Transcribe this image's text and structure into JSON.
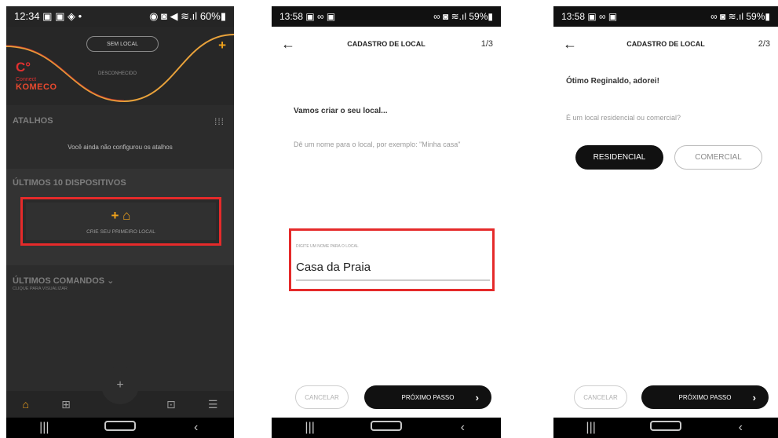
{
  "phone1": {
    "status": {
      "time": "12:34",
      "icons": "▣ ▣ ◈ •",
      "right_icons": "◉ ◙ ◀ ≋.ıl",
      "battery": "60%"
    },
    "location_pill": "SEM LOCAL",
    "add_symbol": "+",
    "logo": {
      "mark": "C°",
      "word": "Connect",
      "brand": "KOMECO"
    },
    "disconnected": "DESCONHECIDO",
    "shortcuts_title": "ATALHOS",
    "shortcuts_empty": "Você ainda não configurou os atalhos",
    "devices_title": "ÚLTIMOS 10 DISPOSITIVOS",
    "create_card": {
      "icons": "+ ⌂",
      "label": "CRIE SEU PRIMEIRO LOCAL"
    },
    "commands_title": "ÚLTIMOS COMANDOS ⌄",
    "commands_sub": "CLIQUE PARA VISUALIZAR",
    "bottom_nav": [
      "⌂",
      "⊞",
      "⊡",
      "☰"
    ],
    "fab": "+",
    "nav": [
      "|||",
      "○",
      "‹"
    ]
  },
  "phone2": {
    "status": {
      "time": "13:58",
      "icons": "▣ ∞ ▣",
      "right_icons": "∞ ◙ ≋.ıl",
      "battery": "59%"
    },
    "back": "←",
    "title": "CADASTRO DE LOCAL",
    "step": "1/3",
    "intro": "Vamos criar o seu local...",
    "hint": "Dê um nome para o local, por exemplo: \"Minha casa\"",
    "field_label": "DIGITE UM NOME PARA O LOCAL",
    "field_value": "Casa da Praia",
    "cancel": "CANCELAR",
    "next": "PRÓXIMO PASSO",
    "next_chevron": "›",
    "nav": [
      "|||",
      "○",
      "‹"
    ]
  },
  "phone3": {
    "status": {
      "time": "13:58",
      "icons": "▣ ∞ ▣",
      "right_icons": "∞ ◙ ≋.ıl",
      "battery": "59%"
    },
    "back": "←",
    "title": "CADASTRO DE LOCAL",
    "step": "2/3",
    "greeting": "Ótimo Reginaldo, adorei!",
    "question": "É um local residencial ou comercial?",
    "residential": "RESIDENCIAL",
    "commercial": "COMERCIAL",
    "cancel": "CANCELAR",
    "next": "PRÓXIMO PASSO",
    "next_chevron": "›",
    "nav": [
      "|||",
      "○",
      "‹"
    ]
  }
}
